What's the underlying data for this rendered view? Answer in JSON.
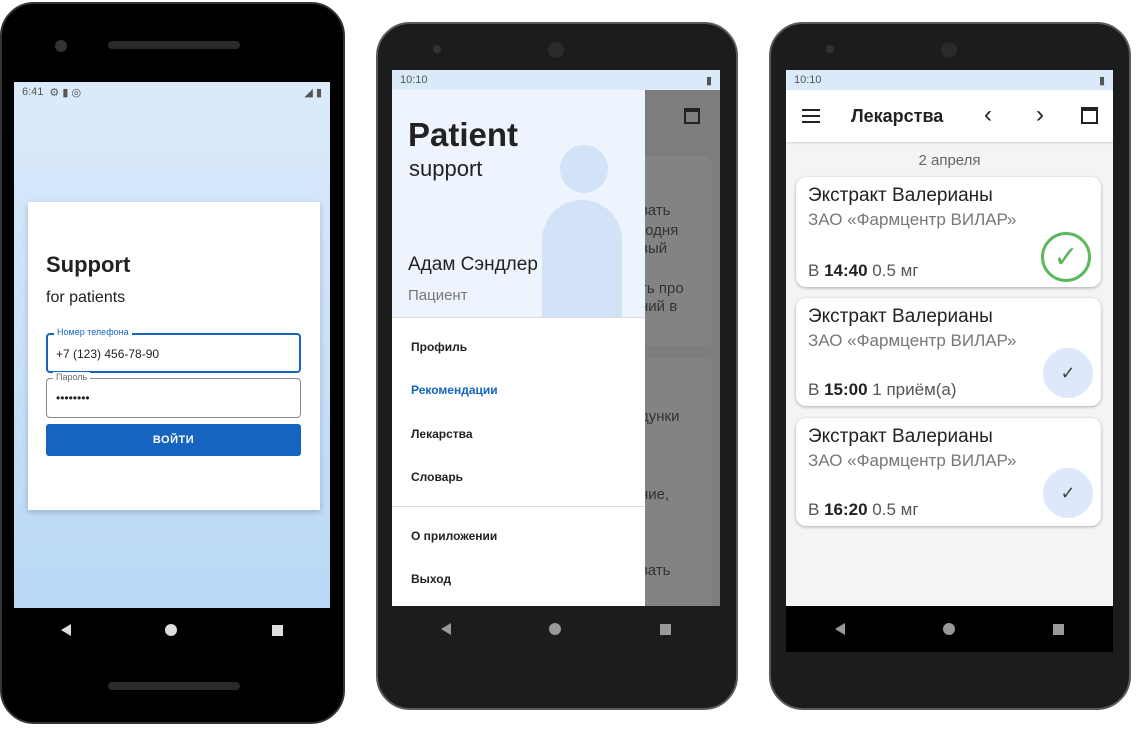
{
  "login": {
    "status_time": "6:41",
    "title": "Support",
    "subtitle": "for patients",
    "phone_label": "Номер телефона",
    "phone_value": "+7 (123) 456-78-90",
    "password_label": "Пароль",
    "password_value": "••••••••",
    "login_button": "ВОЙТИ"
  },
  "drawer": {
    "status_time": "10:10",
    "brand_title": "Patient",
    "brand_sub": "support",
    "user_name": "Адам Сэндлер",
    "user_role": "Пациент",
    "menu": [
      "Профиль",
      "Рекомендации",
      "Лекарства",
      "Словарь"
    ],
    "menu2": [
      "О приложении",
      "Выход"
    ],
    "behind_text": [
      "вать",
      "годня",
      "вый",
      "ть про",
      "ний в",
      "дунки",
      "ние,",
      "вать"
    ]
  },
  "meds": {
    "status_time": "10:10",
    "title": "Лекарства",
    "date": "2 апреля",
    "items": [
      {
        "name": "Экстракт Валерианы",
        "maker": "ЗАО «Фармцентр ВИЛАР»",
        "prefix": "В",
        "time": "14:40",
        "dose": "0.5 мг",
        "done": true
      },
      {
        "name": "Экстракт Валерианы",
        "maker": "ЗАО «Фармцентр ВИЛАР»",
        "prefix": "В",
        "time": "15:00",
        "dose": "1 приём(а)",
        "done": false
      },
      {
        "name": "Экстракт Валерианы",
        "maker": "ЗАО «Фармцентр ВИЛАР»",
        "prefix": "В",
        "time": "16:20",
        "dose": "0.5 мг",
        "done": false
      }
    ]
  },
  "colors": {
    "accent": "#1565c0",
    "check_green": "#5cb85c"
  }
}
